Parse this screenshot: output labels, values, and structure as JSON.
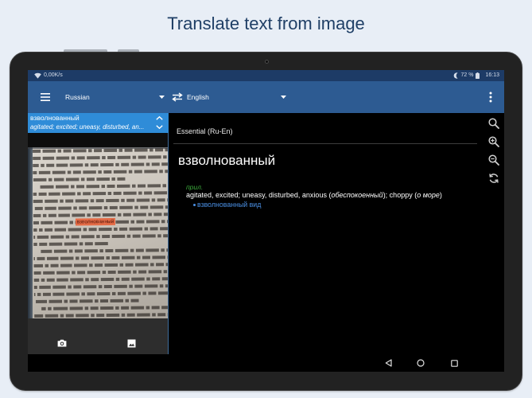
{
  "colors": {
    "page_bg": "#e8eef6",
    "title": "#1f3f66",
    "status_bar": "#1d3b66",
    "app_bar": "#2d5b92",
    "suggestion_bg": "#2f8cd8",
    "pos_label": "#3cab3c",
    "example_link": "#4a8fe3",
    "photo_highlight": "#e8643c"
  },
  "promo": {
    "title": "Translate text from image"
  },
  "status_bar": {
    "network_speed": "0,00K/s",
    "battery": "72 %",
    "time": "16:13",
    "icons": [
      "wifi-icon",
      "moon-icon",
      "battery-icon"
    ]
  },
  "app_bar": {
    "source_language": "Russian",
    "target_language": "English",
    "icons": [
      "menu-icon",
      "swap-languages-icon",
      "more-vert-icon"
    ]
  },
  "suggestion": {
    "word": "взволнованный",
    "preview": "agitated; excited; uneasy, disturbed, an..."
  },
  "photo": {
    "highlighted_word": "взволнованный"
  },
  "source_toolbar": {
    "icons": [
      "camera-icon",
      "image-icon"
    ]
  },
  "dictionary": {
    "name": "Essential (Ru-En)",
    "headword": "взволнованный",
    "part_of_speech": "прил.",
    "definition_parts": [
      "agitated, excited; uneasy, disturbed, anxious (",
      "обеспокоенный",
      "); choppy (",
      "о море",
      ")"
    ],
    "example": "взволнованный вид"
  },
  "side_tools": {
    "icons": [
      "search-icon",
      "zoom-in-icon",
      "zoom-out-icon",
      "rotate-icon"
    ]
  },
  "nav_bar": {
    "icons": [
      "back-icon",
      "home-icon",
      "recents-icon"
    ]
  }
}
